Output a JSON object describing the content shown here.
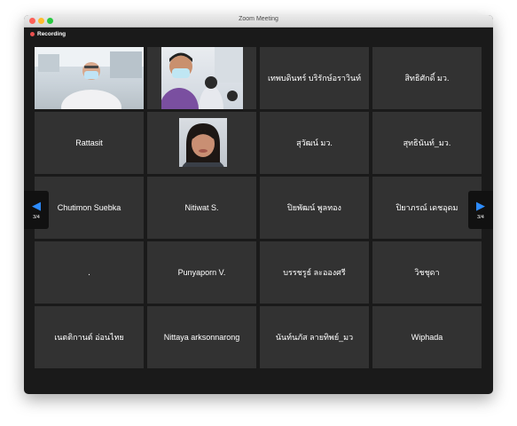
{
  "window": {
    "title": "Zoom Meeting"
  },
  "recording": {
    "label": "Recording"
  },
  "pagination": {
    "left": "3/4",
    "right": "3/4"
  },
  "participants": [
    "",
    "",
    "เทพบดินทร์ บริรักษ์อราวินท์",
    "สิทธิศักดิ์ มว.",
    "Rattasit",
    "",
    "สุวัฒน์ มว.",
    "สุทธินันท์_มว.",
    "Chutimon Suebka",
    "Nitiwat S.",
    "ปิยพัฒน์ พูลทอง",
    "ปิยาภรณ์ เดชอุดม",
    ".",
    "Punyaporn V.",
    "บรรชรูธ์ ละอองศรี",
    "วิชชุดา",
    "เนตติกานต์ อ่อนไทย",
    "Nittaya arksonnarong",
    "นันท์นภัส ลายทิพย์_มว",
    "Wiphada"
  ],
  "colors": {
    "accent": "#2d8cff",
    "recording": "#e8504f",
    "tile": "#323232"
  }
}
